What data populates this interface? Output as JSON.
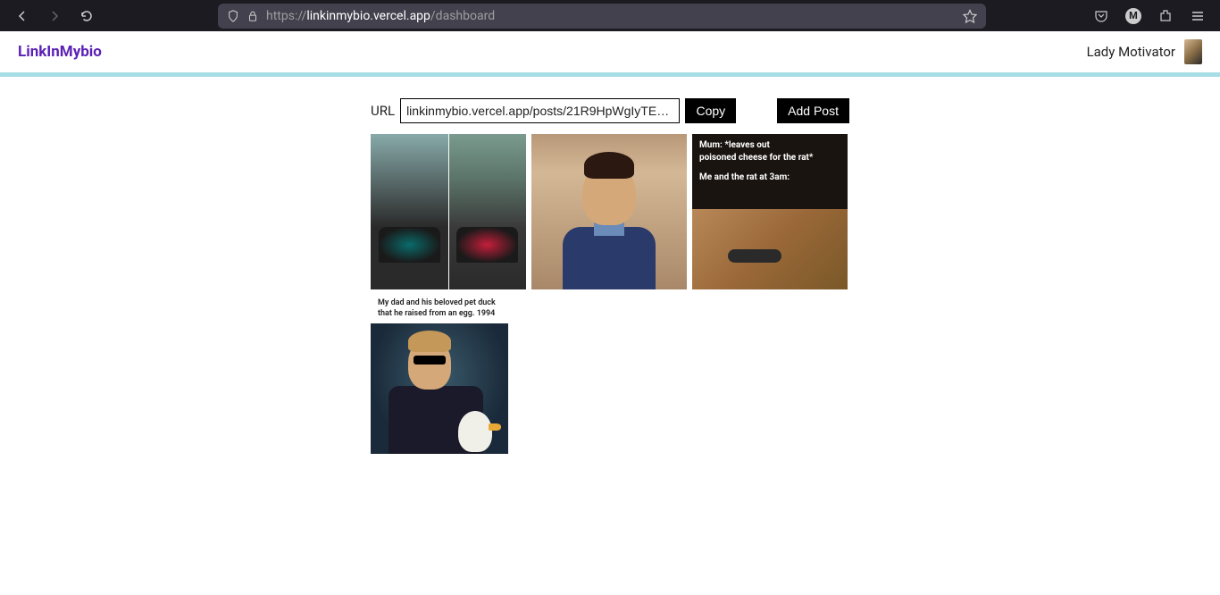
{
  "browser": {
    "url_display_prefix": "https://",
    "url_display_host": "linkinmybio.vercel.app",
    "url_display_path": "/dashboard"
  },
  "header": {
    "logo": "LinkInMybio",
    "username": "Lady Motivator"
  },
  "url_row": {
    "label": "URL",
    "value": "linkinmybio.vercel.app/posts/21R9HpWgIyTEqYCgTIyg...",
    "copy_label": "Copy",
    "add_label": "Add Post"
  },
  "posts": [
    {
      "name": "post-f1-comparison"
    },
    {
      "name": "post-man-portrait"
    },
    {
      "name": "post-rat-meme",
      "line1": "Mum: *leaves out",
      "line2": "poisoned cheese for the rat*",
      "line3": "Me and the rat at 3am:"
    },
    {
      "name": "post-duck-dad",
      "caption": "My dad and his beloved pet duck that he raised from an egg. 1994"
    }
  ]
}
